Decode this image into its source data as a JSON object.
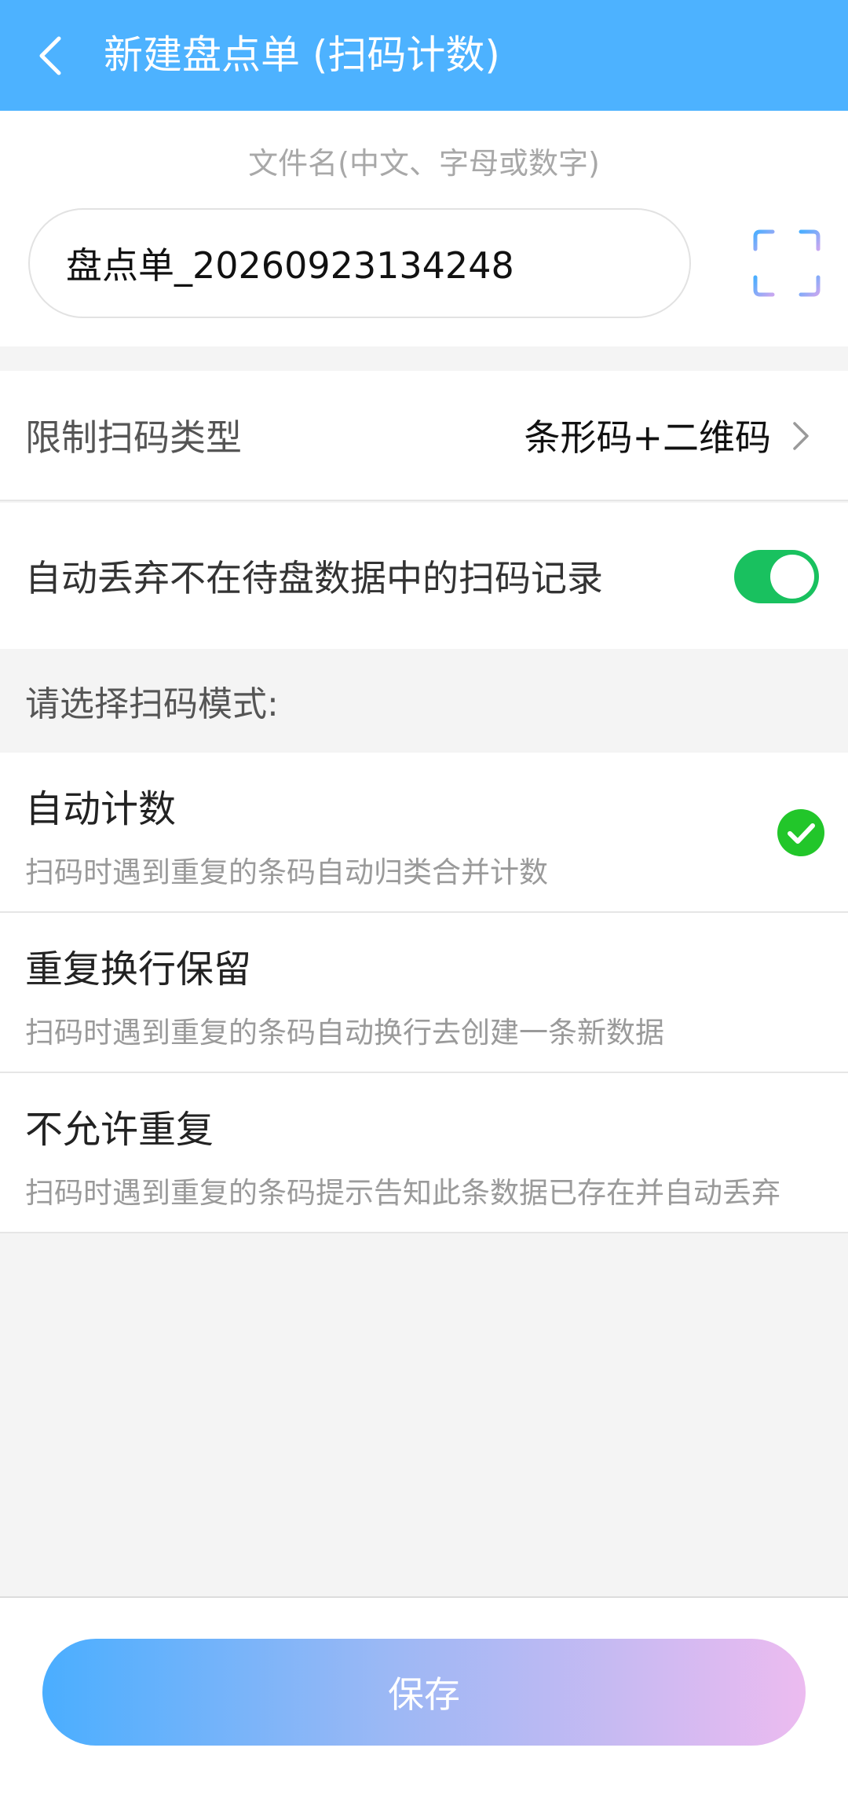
{
  "header": {
    "title": "新建盘点单 (扫码计数)",
    "back_icon": "chevron-left-icon"
  },
  "file": {
    "hint": "文件名(中文、字母或数字)",
    "name_value": "盘点单_20260923134248",
    "scan_icon": "scan-frame-icon"
  },
  "settings": {
    "limit_label": "限制扫码类型",
    "limit_value": "条形码+二维码",
    "discard_label": "自动丢弃不在待盘数据中的扫码记录",
    "discard_enabled": true
  },
  "modes": {
    "header": "请选择扫码模式:",
    "items": [
      {
        "title": "自动计数",
        "desc": "扫码时遇到重复的条码自动归类合并计数",
        "selected": true
      },
      {
        "title": "重复换行保留",
        "desc": "扫码时遇到重复的条码自动换行去创建一条新数据",
        "selected": false
      },
      {
        "title": "不允许重复",
        "desc": "扫码时遇到重复的条码提示告知此条数据已存在并自动丢弃",
        "selected": false
      }
    ]
  },
  "footer": {
    "save_label": "保存"
  },
  "colors": {
    "header_bg": "#4db2ff",
    "toggle_on": "#19c15f",
    "check": "#22c62a",
    "save_gradient_start": "#4aaeff",
    "save_gradient_end": "#ecbbf0"
  }
}
